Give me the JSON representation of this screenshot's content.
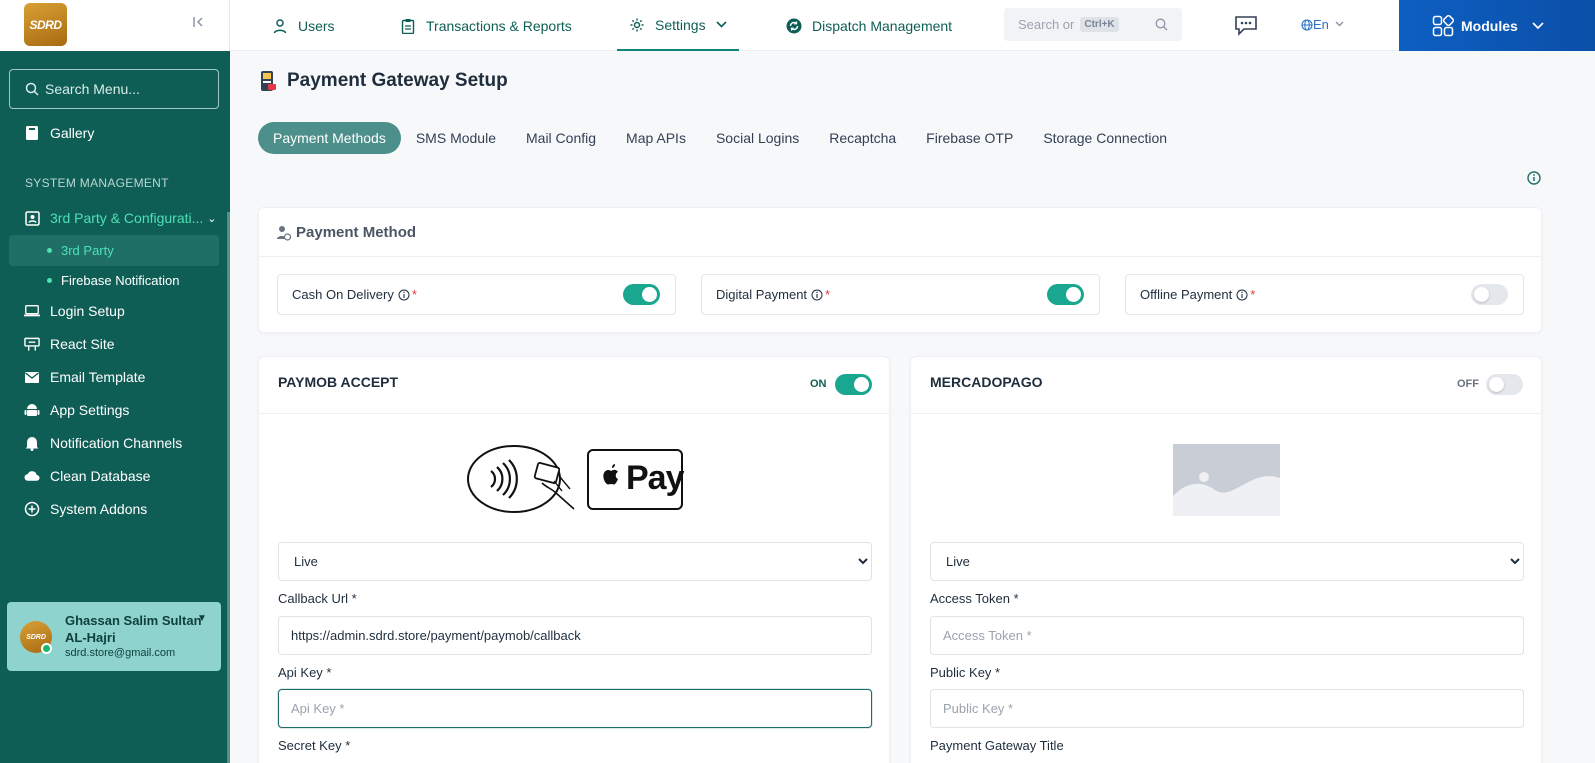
{
  "sidebar": {
    "logo_text": "SDRD",
    "search_placeholder": "Search Menu...",
    "gallery": "Gallery",
    "section_title": "SYSTEM MANAGEMENT",
    "group_label": "3rd Party & Configurati...",
    "sub_items": [
      "3rd Party",
      "Firebase Notification"
    ],
    "items": [
      "Login Setup",
      "React Site",
      "Email Template",
      "App Settings",
      "Notification Channels",
      "Clean Database",
      "System Addons"
    ],
    "user": {
      "avatar_text": "SDRD",
      "name": "Ghassan Salim Sultan AL-Hajri",
      "email": "sdrd.store@gmail.com"
    }
  },
  "topbar": {
    "nav": [
      "Users",
      "Transactions & Reports",
      "Settings",
      "Dispatch Management"
    ],
    "active_nav": "Settings",
    "search_placeholder": "Search or",
    "search_shortcut": "Ctrl+K",
    "language": "En",
    "modules": "Modules"
  },
  "page": {
    "title": "Payment Gateway Setup",
    "tabs": [
      "Payment Methods",
      "SMS Module",
      "Mail Config",
      "Map APIs",
      "Social Logins",
      "Recaptcha",
      "Firebase OTP",
      "Storage Connection"
    ],
    "active_tab": "Payment Methods"
  },
  "payment_method": {
    "title": "Payment Method",
    "methods": [
      {
        "label": "Cash On Delivery",
        "required": "*",
        "enabled": true
      },
      {
        "label": "Digital Payment",
        "required": "*",
        "enabled": true
      },
      {
        "label": "Offline Payment",
        "required": "*",
        "enabled": false
      }
    ]
  },
  "gateways": [
    {
      "title": "PAYMOB ACCEPT",
      "status": "ON",
      "enabled": true,
      "logo_text": "Pay",
      "mode_options": [
        "Live"
      ],
      "mode": "Live",
      "fields": [
        {
          "label": "Callback Url *",
          "value": "https://admin.sdrd.store/payment/paymob/callback",
          "placeholder": ""
        },
        {
          "label": "Api Key *",
          "value": "",
          "placeholder": "Api Key *"
        },
        {
          "label": "Secret Key *",
          "value": "",
          "placeholder": ""
        }
      ]
    },
    {
      "title": "MERCADOPAGO",
      "status": "OFF",
      "enabled": false,
      "mode_options": [
        "Live"
      ],
      "mode": "Live",
      "fields": [
        {
          "label": "Access Token *",
          "value": "",
          "placeholder": "Access Token *"
        },
        {
          "label": "Public Key *",
          "value": "",
          "placeholder": "Public Key *"
        },
        {
          "label": "Payment Gateway Title",
          "value": "",
          "placeholder": ""
        }
      ]
    }
  ],
  "colors": {
    "sidebar_bg": "#0f5e56",
    "accent": "#1aa78f",
    "active_tab": "#4d8f8a",
    "modules_bg": "#0d5fc2",
    "required": "#e03b3b"
  }
}
